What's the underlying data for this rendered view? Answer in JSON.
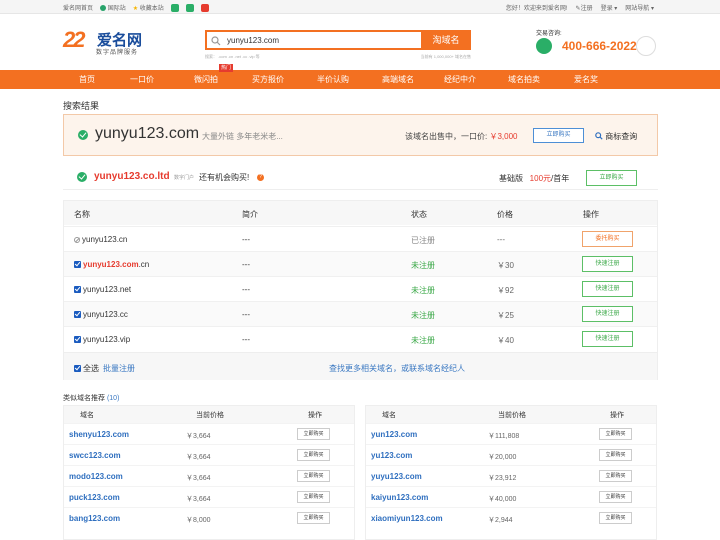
{
  "topbar": {
    "home": "爱名网首页",
    "intl": "国际站",
    "fav": "收藏本站",
    "welcome": "您好！欢迎来到爱名网!",
    "register": "注册",
    "login": "登录",
    "site_nav": "网站导航"
  },
  "logo": {
    "num": "22",
    "name": "爱名网",
    "slogan": "数字品牌服务"
  },
  "search": {
    "value": "yunyu123.com",
    "button": "淘域名",
    "hints": "搜索：  .com  .cn  .net  .cc  .vip  等",
    "count": "当前有 1,000,000+ 域名在售"
  },
  "contact": {
    "label": "交易咨询:",
    "phone": "400-666-2022"
  },
  "nav": {
    "items": [
      "首页",
      "一口价",
      "微闪拍",
      "买方报价",
      "半价认购",
      "高端域名",
      "经纪中介",
      "域名拍卖",
      "爱名奖"
    ],
    "hot_badge": "热门"
  },
  "results_title": "搜索结果",
  "main_result": {
    "domain": "yunyu123.com",
    "desc": "大量外链 多年老米老...",
    "forsale_text": "该域名出售中，一口价:",
    "price": "￥3,000",
    "buy": "立即购买",
    "trademark": "商标查询"
  },
  "second_result": {
    "domain": "yunyu123.co.ltd",
    "tag": "数字门户",
    "chance": "还有机会购买!",
    "q": "?",
    "plan_label": "基础版",
    "plan_price": "100元",
    "plan_unit": "/首年",
    "buy": "立即购买"
  },
  "table": {
    "headers": [
      "名称",
      "简介",
      "状态",
      "价格",
      "操作"
    ],
    "rows": [
      {
        "name": "yunyu123.cn",
        "intro": "---",
        "status": "已注册",
        "price": "---",
        "op": "委托购买"
      },
      {
        "name_main": "yunyu123.com",
        "name_suffix": ".cn",
        "intro": "---",
        "status": "未注册",
        "price": "￥30",
        "op": "快速注册"
      },
      {
        "name": "yunyu123.net",
        "intro": "---",
        "status": "未注册",
        "price": "￥92",
        "op": "快速注册"
      },
      {
        "name": "yunyu123.cc",
        "intro": "---",
        "status": "未注册",
        "price": "￥25",
        "op": "快速注册"
      },
      {
        "name": "yunyu123.vip",
        "intro": "---",
        "status": "未注册",
        "price": "￥40",
        "op": "快速注册"
      }
    ],
    "select_all": "全选",
    "batch": "批量注册",
    "more": "查找更多相关域名，或联系域名经纪人"
  },
  "similar": {
    "title": "类似域名推荐",
    "count": "(10)",
    "headers": [
      "域名",
      "当前价格",
      "操作"
    ],
    "left": [
      {
        "domain": "shenyu123.com",
        "price": "￥3,664",
        "op": "立即购买"
      },
      {
        "domain": "swcc123.com",
        "price": "￥3,664",
        "op": "立即购买"
      },
      {
        "domain": "modo123.com",
        "price": "￥3,664",
        "op": "立即购买"
      },
      {
        "domain": "puck123.com",
        "price": "￥3,664",
        "op": "立即购买"
      },
      {
        "domain": "bang123.com",
        "price": "￥8,000",
        "op": "立即购买"
      }
    ],
    "right": [
      {
        "domain": "yun123.com",
        "price": "￥111,808",
        "op": "立即购买"
      },
      {
        "domain": "yu123.com",
        "price": "￥20,000",
        "op": "立即购买"
      },
      {
        "domain": "yuyu123.com",
        "price": "￥23,912",
        "op": "立即购买"
      },
      {
        "domain": "kaiyun123.com",
        "price": "￥40,000",
        "op": "立即购买"
      },
      {
        "domain": "xiaomiyun123.com",
        "price": "￥2,944",
        "op": "立即购买"
      }
    ]
  },
  "colors": {
    "brand_orange": "#f37021",
    "brand_blue": "#1a4d9c",
    "link_blue": "#2f6fbf",
    "green": "#2aae67",
    "red": "#e63b2e"
  }
}
